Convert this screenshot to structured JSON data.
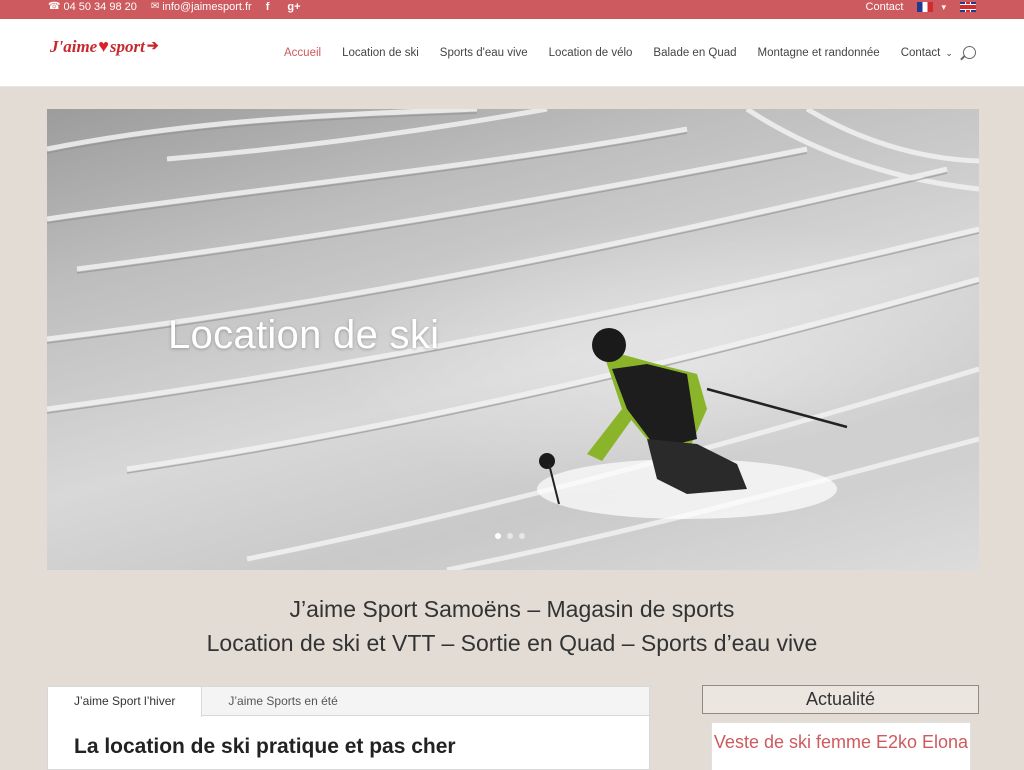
{
  "topbar": {
    "phone": "04 50 34 98 20",
    "email": "info@jaimesport.fr",
    "social": [
      "f",
      "g+"
    ],
    "contact_label": "Contact"
  },
  "logo": {
    "left": "J'aime",
    "right": "sport"
  },
  "nav": {
    "items": [
      "Accueil",
      "Location de ski",
      "Sports d'eau vive",
      "Location de vélo",
      "Balade en Quad",
      "Montagne et randonnée",
      "Contact"
    ],
    "active": "Accueil"
  },
  "hero": {
    "title": "Location de ski",
    "slides": 3,
    "active_slide": 0
  },
  "intro": {
    "line1": "J’aime Sport Samoëns – Magasin de sports",
    "line2": "Location de ski et VTT – Sortie en Quad – Sports d’eau vive"
  },
  "tabs": {
    "items": [
      "J’aime Sport l’hiver",
      "J’aime Sports en été"
    ],
    "active": 0,
    "heading": "La location de ski pratique et pas cher"
  },
  "sidebar": {
    "title": "Actualité",
    "card_title": "Veste de ski femme E2ko Elona"
  },
  "colors": {
    "accent": "#cd5a5e",
    "topbar": "#cd5a5e",
    "background": "#e2dcd5"
  }
}
